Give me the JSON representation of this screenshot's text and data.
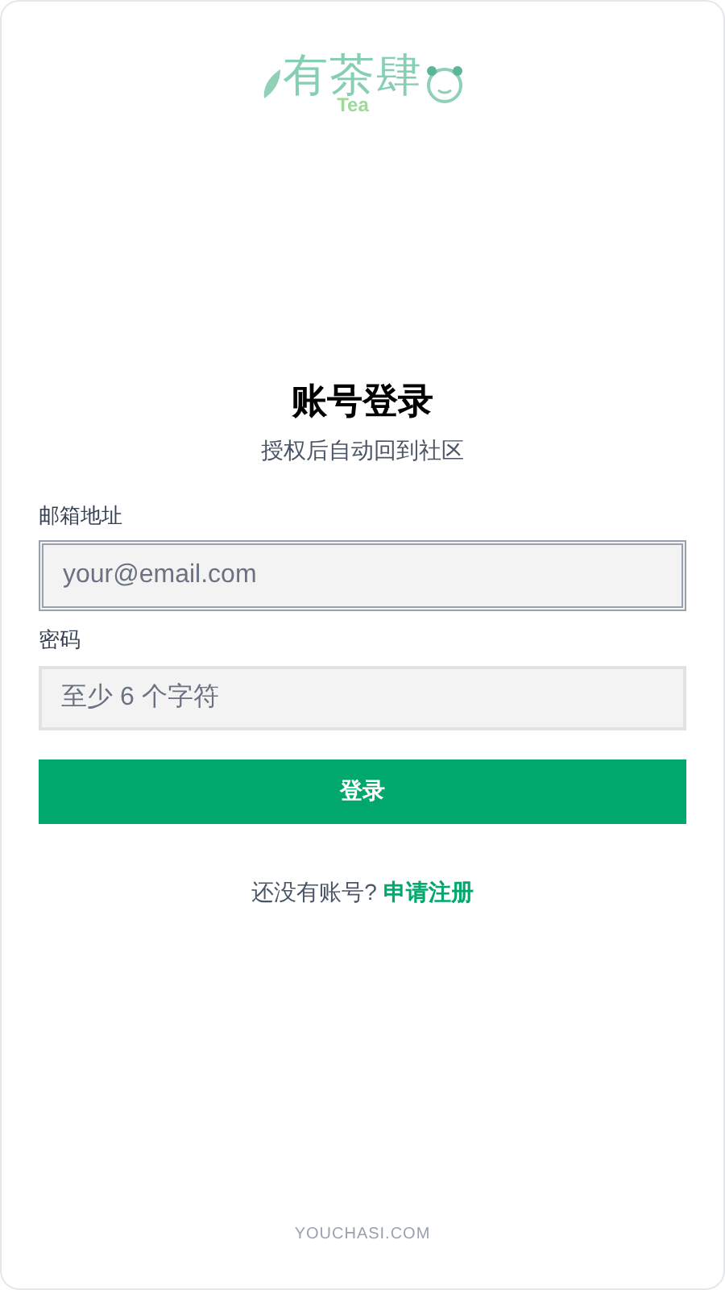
{
  "logo": {
    "name": "有茶肆",
    "sub": "Tea"
  },
  "heading": {
    "title": "账号登录",
    "subtitle": "授权后自动回到社区"
  },
  "fields": [
    {
      "label": "邮箱地址",
      "placeholder": "your@email.com",
      "focused": true
    },
    {
      "label": "密码",
      "placeholder": "至少 6 个字符",
      "focused": false
    }
  ],
  "submit": "登录",
  "signup": {
    "prompt": "还没有账号?",
    "link": "申请注册"
  },
  "footer": "YOUCHASI.COM"
}
